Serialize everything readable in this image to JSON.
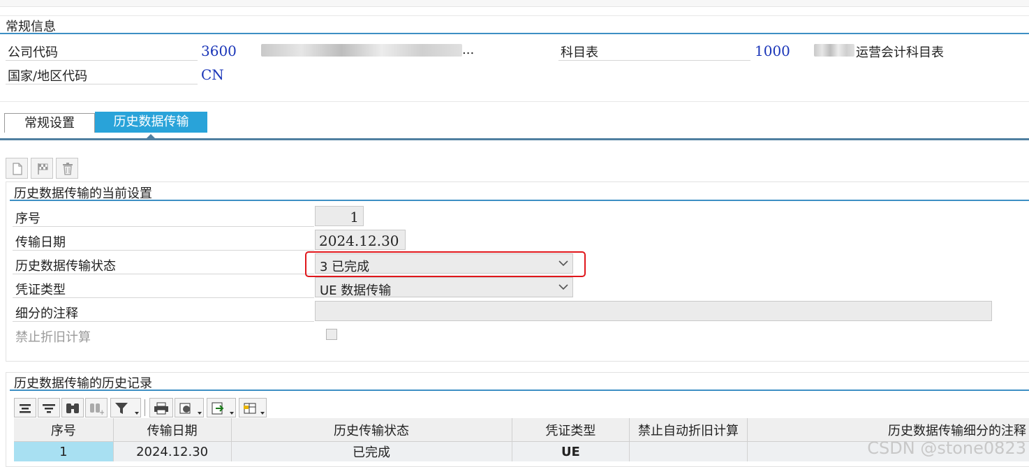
{
  "general": {
    "section_title": "常规信息",
    "company_code_label": "公司代码",
    "company_code": "3600",
    "company_name": "...",
    "chart_label": "科目表",
    "chart_value": "1000",
    "chart_desc": "运营会计科目表",
    "country_label": "国家/地区代码",
    "country_value": "CN"
  },
  "tabs": [
    {
      "label": "常规设置",
      "active": false
    },
    {
      "label": "历史数据传输",
      "active": true
    }
  ],
  "toolbar": {
    "icons": [
      "new-document-icon",
      "checkered-flag-icon",
      "trash-icon"
    ]
  },
  "current": {
    "title": "历史数据传输的当前设置",
    "seq_label": "序号",
    "seq_value": "1",
    "date_label": "传输日期",
    "date_value": "2024.12.30",
    "status_label": "历史数据传输状态",
    "status_value": "3 已完成",
    "doctype_label": "凭证类型",
    "doctype_value": "UE 数据传输",
    "note_label": "细分的注释",
    "note_value": "",
    "block_label": "禁止折旧计算",
    "block_checked": false
  },
  "history": {
    "title": "历史数据传输的历史记录",
    "columns": [
      "序号",
      "传输日期",
      "历史传输状态",
      "凭证类型",
      "禁止自动折旧计算",
      "历史数据传输细分的注释"
    ],
    "rows": [
      [
        "1",
        "2024.12.30",
        "已完成",
        "UE",
        "",
        ""
      ]
    ]
  },
  "watermark": "CSDN @stone0823",
  "colors": {
    "accent_blue": "#3d8fc4",
    "tab_active": "#29a3d9",
    "value_blue": "#1a35b8",
    "highlight_red": "#e0161b",
    "selected_cell": "#a8e0f2"
  }
}
